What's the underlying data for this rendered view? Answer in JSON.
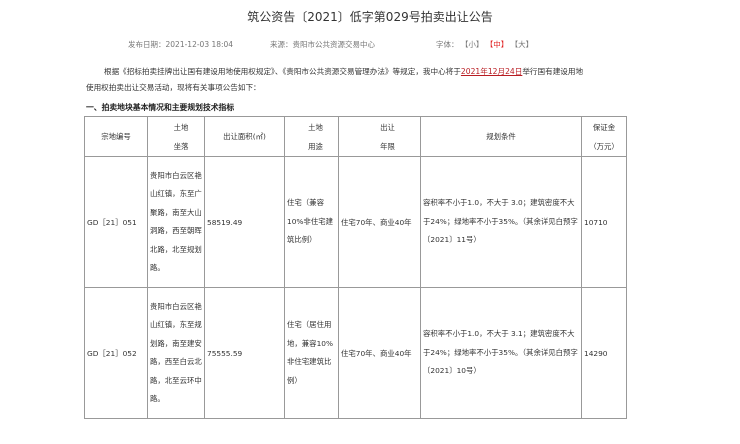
{
  "page": {
    "title": "筑公资告〔2021〕低字第029号拍卖出让公告",
    "publish_label": "发布日期：2021-12-03 18:04",
    "source_label": "来源：贵阳市公共资源交易中心",
    "font_size": {
      "label": "字体：",
      "small": "【小】",
      "medium": "【中】",
      "large": "【大】"
    }
  },
  "intro": {
    "text_before": "根据《招标拍卖挂牌出让国有建设用地使用权规定》、《贵阳市公共资源交易管理办法》等规定，我中心将于",
    "date": "2021年12月24日",
    "text_after": "举行国有建设用地",
    "line2": "使用权拍卖出让交易活动，现将有关事项公告如下："
  },
  "section_title": "一、拍卖地块基本情况和主要规划技术指标",
  "table": {
    "headers": {
      "code": "宗地编号",
      "location_1": "土地",
      "location_2": "坐落",
      "area": "出让面积(㎡)",
      "use_1": "土地",
      "use_2": "用途",
      "term_1": "出让",
      "term_2": "年限",
      "planning": "规划条件",
      "deposit_1": "保证金",
      "deposit_2": "（万元）"
    },
    "rows": [
      {
        "code": "GD［21］051",
        "location": "贵阳市白云区艳山红镇，东至广聚路，南至大山洞路，西至朝晖北路，北至规划路。",
        "area": "58519.49",
        "use": "住宅（兼容10%非住宅建筑比例）",
        "term": "住宅70年、商业40年",
        "planning": "容积率不小于1.0，不大于 3.0；建筑密度不大于24%；绿地率不小于35%。（其余详见白预字〔2021〕11号）",
        "deposit": "10710"
      },
      {
        "code": "GD［21］052",
        "location": "贵阳市白云区艳山红镇，东至规划路，南至建安路，西至白云北路，北至云环中路。",
        "area": "75555.59",
        "use": "住宅（居住用地，兼容10%非住宅建筑比例）",
        "term": "住宅70年、商业40年",
        "planning": "容积率不小于1.0，不大于 3.1；建筑密度不大于24%；绿地率不小于35%。（其余详见白预字〔2021〕10号）",
        "deposit": "14290"
      }
    ]
  }
}
